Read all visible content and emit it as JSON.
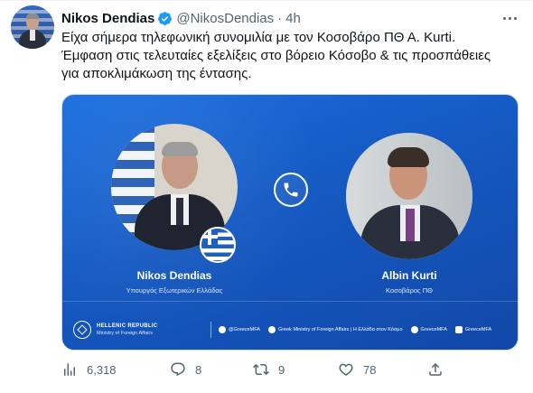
{
  "author": {
    "name": "Nikos Dendias",
    "handle": "@NikosDendias",
    "separator": "·",
    "time": "4h"
  },
  "tweet": {
    "lines": [
      "Είχα σήμερα τηλεφωνική συνομιλία με τον Κοσοβάρο ΠΘ Α. Kurti.",
      "Έμφαση στις τελευταίες εξελίξεις στο βόρειο Κόσοβο & τις προσπάθειες",
      "για αποκλιμάκωση της έντασης."
    ]
  },
  "media": {
    "left_person": {
      "name": "Nikos Dendias",
      "role": "Υπουργός Εξωτερικών Ελλάδας"
    },
    "right_person": {
      "name": "Albin Kurti",
      "role": "Κοσοβάρος ΠΘ"
    },
    "ministry": {
      "line1": "HELLENIC REPUBLIC",
      "line2": "Ministry of Foreign Affairs"
    },
    "socials": [
      {
        "icon": "twitter-icon",
        "label": "@GreeceMFA"
      },
      {
        "icon": "facebook-icon",
        "label": "Greek Ministry of Foreign Affairs | Η Ελλάδα στον Κόσμο"
      },
      {
        "icon": "flickr-icon",
        "label": "GreeceMFA"
      },
      {
        "icon": "youtube-icon",
        "label": "GreeceMFA"
      }
    ]
  },
  "actions": {
    "views": "6,318",
    "replies": "8",
    "retweets": "9",
    "likes": "78"
  },
  "colors": {
    "accent": "#1d9bf0",
    "media_blue": "#1559c2",
    "text_secondary": "#536471"
  }
}
